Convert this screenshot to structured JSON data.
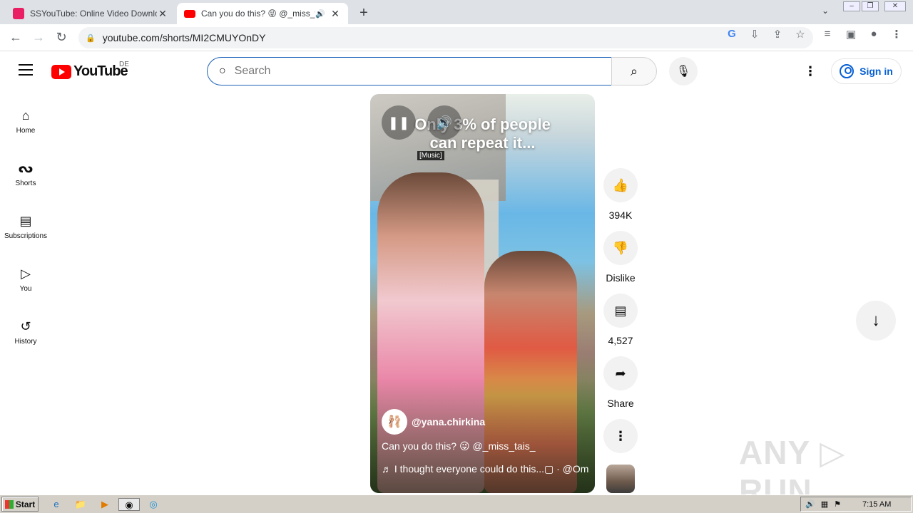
{
  "browser": {
    "tabs": [
      {
        "title": "SSYouTube: Online Video Downloader",
        "favicon_color": "#e91e63"
      },
      {
        "title": "Can you do this? 😜 @_miss_tais",
        "favicon_color": "#ff0000",
        "audio": "🔊"
      }
    ],
    "close_glyph": "✕",
    "new_tab_glyph": "+",
    "tab_menu_glyph": "⌄",
    "url": "youtube.com/shorts/MI2CMUYOnDY"
  },
  "youtube": {
    "logo_text": "YouTube",
    "region": "DE",
    "search_placeholder": "Search",
    "sign_in": "Sign in",
    "guide": [
      {
        "label": "Home",
        "icon": "⌂"
      },
      {
        "label": "Shorts",
        "icon": "ᔓ"
      },
      {
        "label": "Subscriptions",
        "icon": "▤"
      },
      {
        "label": "You",
        "icon": "▷"
      },
      {
        "label": "History",
        "icon": "↺"
      }
    ]
  },
  "short": {
    "caption_text": "Only 3% of people\ncan repeat it...",
    "music_tag": "[Music]",
    "channel": "@yana.chirkina",
    "title": "Can you do this? 😜 @_miss_tais_",
    "music": "♬ I thought everyone could do this...▢ · @Om"
  },
  "actions": {
    "like_count": "394K",
    "dislike_label": "Dislike",
    "comments_count": "4,527",
    "share_label": "Share"
  },
  "watermark": "ANY ▷ RUN",
  "taskbar": {
    "start_label": "Start",
    "clock": "7:15 AM"
  }
}
